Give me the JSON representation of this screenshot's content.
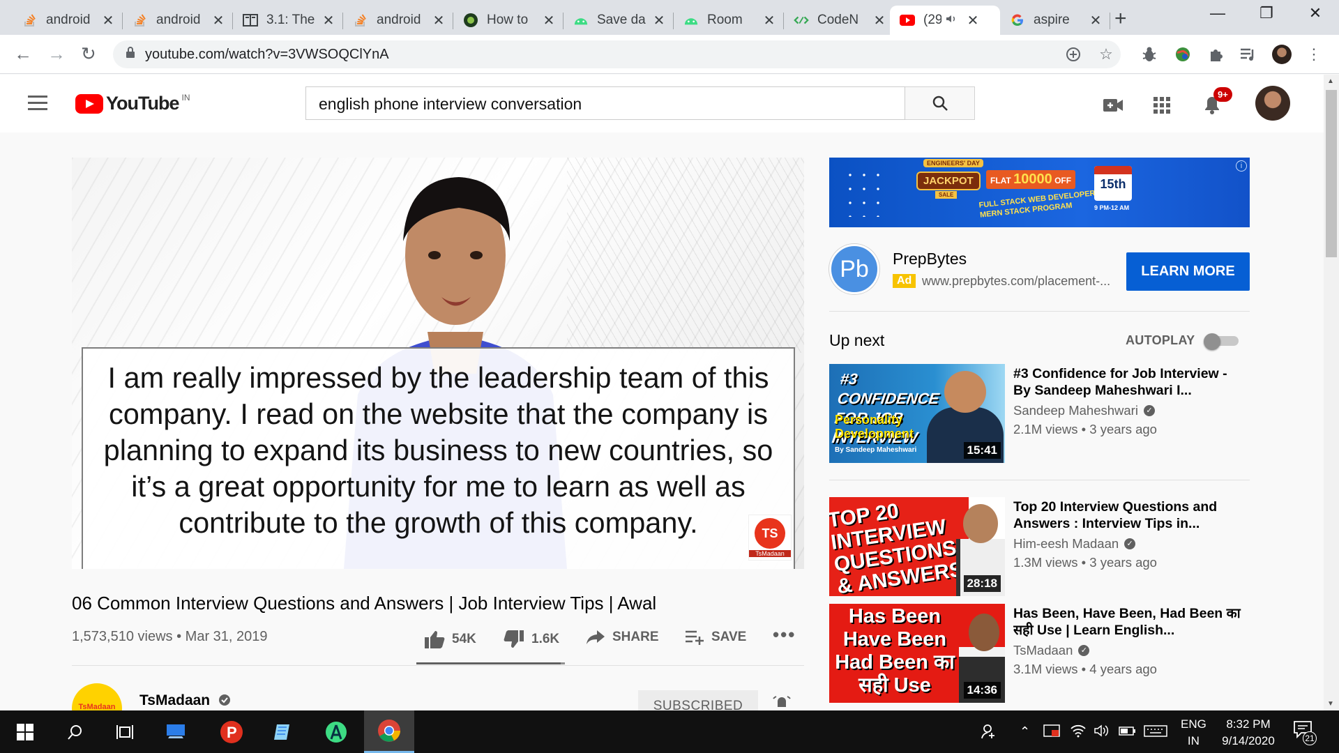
{
  "browser": {
    "tabs": [
      {
        "title": "android",
        "icon": "stackoverflow-icon",
        "active": false
      },
      {
        "title": "android",
        "icon": "stackoverflow-icon",
        "active": false
      },
      {
        "title": "3.1: The",
        "icon": "book-icon",
        "active": false
      },
      {
        "title": "android",
        "icon": "stackoverflow-icon",
        "active": false
      },
      {
        "title": "How to",
        "icon": "green-circle-icon",
        "active": false
      },
      {
        "title": "Save da",
        "icon": "android-icon",
        "active": false
      },
      {
        "title": "Room",
        "icon": "android-icon",
        "active": false
      },
      {
        "title": "CodeN",
        "icon": "codelab-icon",
        "active": false
      },
      {
        "title": "(29",
        "icon": "youtube-icon",
        "active": true
      },
      {
        "title": "aspire",
        "icon": "google-icon",
        "active": false
      }
    ],
    "url": "youtube.com/watch?v=3VWSOQClYnA"
  },
  "youtube": {
    "logo_text": "YouTube",
    "country": "IN",
    "search_query": "english phone interview conversation",
    "notification_count": "9+"
  },
  "video": {
    "caption": "I am really impressed by the leadership team of this company. I read on the website that the company is planning to expand its business to new countries, so it’s a great opportunity for me to learn as well as contribute to the growth of this company.",
    "watermark": "TsMadaan",
    "title": "06 Common Interview Questions and Answers | Job Interview Tips | Awal",
    "views": "1,573,510 views",
    "date": "Mar 31, 2019",
    "likes": "54K",
    "dislikes": "1.6K",
    "like_ratio": 0.97,
    "share_label": "SHARE",
    "save_label": "SAVE",
    "channel": "TsMadaan",
    "subscribe_label": "SUBSCRIBED"
  },
  "ad": {
    "banner": {
      "engineers_day": "ENGINEERS' DAY",
      "jackpot": "JACKPOT",
      "sale": "SALE",
      "flat_prefix": "FLAT",
      "amount": "10000",
      "off": "OFF",
      "program_line1": "FULL STACK WEB DEVELOPER",
      "program_line2": "MERN STACK PROGRAM",
      "date": "15th",
      "time": "9 PM-12 AM"
    },
    "advertiser": "PrepBytes",
    "logo_text": "Pb",
    "tag": "Ad",
    "url": "www.prepbytes.com/placement-...",
    "cta": "LEARN MORE"
  },
  "sidebar": {
    "up_next": "Up next",
    "autoplay": "AUTOPLAY",
    "autoplay_on": false,
    "videos": [
      {
        "title": "#3 Confidence for Job Interview - By Sandeep Maheshwari I...",
        "channel": "Sandeep Maheshwari",
        "verified": true,
        "meta": "2.1M views • 3 years ago",
        "duration": "15:41",
        "thumb_text1": "#3 CONFIDENCE FOR JOB INTERVIEW",
        "thumb_text2": "Personality Development",
        "thumb_text3": "By Sandeep Maheshwari"
      },
      {
        "title": "Top 20 Interview Questions and Answers : Interview Tips in...",
        "channel": "Him-eesh Madaan",
        "verified": true,
        "meta": "1.3M views • 3 years ago",
        "duration": "28:18",
        "thumb_text1": "TOP 20 INTERVIEW QUESTIONS & ANSWERS"
      },
      {
        "title": "Has Been, Have Been, Had Been का सही Use | Learn English...",
        "channel": "TsMadaan",
        "verified": true,
        "meta": "3.1M views • 4 years ago",
        "duration": "14:36",
        "thumb_text1": "Has Been Have Been Had Been का सही Use"
      }
    ]
  },
  "taskbar": {
    "language": "ENG",
    "region": "IN",
    "time": "8:32 PM",
    "date": "9/14/2020",
    "notifications": "21"
  }
}
